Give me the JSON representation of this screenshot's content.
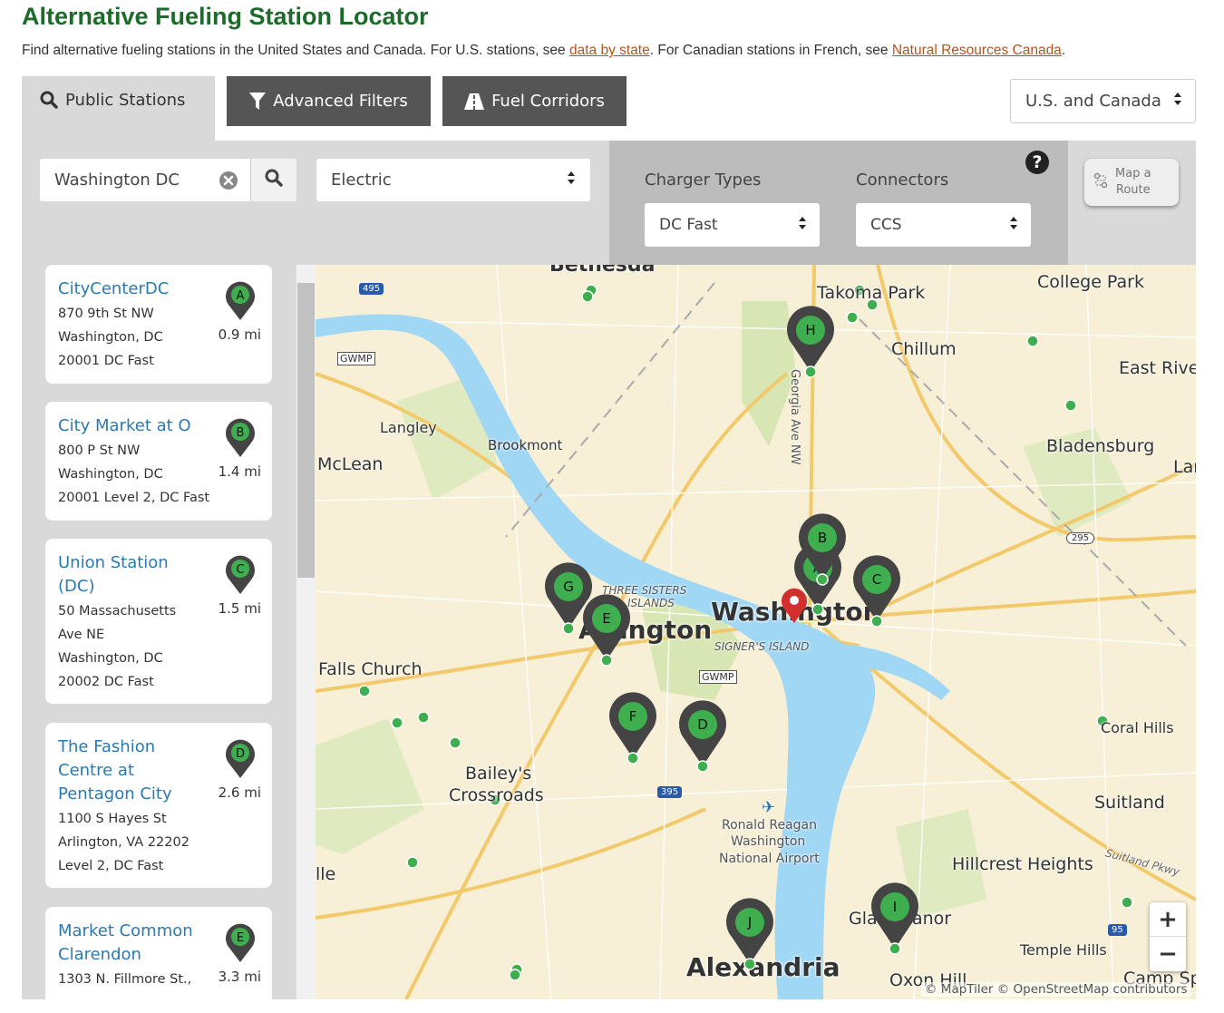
{
  "header": {
    "title": "Alternative Fueling Station Locator",
    "intro_prefix": "Find alternative fueling stations in the United States and Canada. For U.S. stations, see ",
    "intro_link1": "data by state",
    "intro_middle": ". For Canadian stations in French, see ",
    "intro_link2": "Natural Resources Canada",
    "intro_suffix": "."
  },
  "tabs": {
    "public": "Public Stations",
    "advanced": "Advanced Filters",
    "corridors": "Fuel Corridors"
  },
  "region": {
    "selected": "U.S. and Canada"
  },
  "search": {
    "location": "Washington DC",
    "fuel": "Electric"
  },
  "filters": {
    "charger_label": "Charger Types",
    "charger_value": "DC Fast",
    "connector_label": "Connectors",
    "connector_value": "CCS",
    "help": "?",
    "route_line1": "Map a",
    "route_line2": "Route"
  },
  "stations": [
    {
      "letter": "A",
      "name": "CityCenterDC",
      "address": [
        "870 9th St NW",
        "Washington, DC",
        "20001 DC Fast"
      ],
      "distance": "0.9 mi"
    },
    {
      "letter": "B",
      "name": "City Market at O",
      "address": [
        "800 P St NW",
        "Washington, DC",
        "20001 Level 2, DC Fast"
      ],
      "distance": "1.4 mi"
    },
    {
      "letter": "C",
      "name": "Union Station (DC)",
      "address": [
        "50 Massachusetts",
        "Ave NE",
        "Washington, DC",
        "20002 DC Fast"
      ],
      "distance": "1.5 mi"
    },
    {
      "letter": "D",
      "name": "The Fashion Centre at Pentagon City",
      "address": [
        "1100 S Hayes St",
        "Arlington, VA 22202",
        "Level 2, DC Fast"
      ],
      "distance": "2.6 mi"
    },
    {
      "letter": "E",
      "name": "Market Common Clarendon",
      "address": [
        "1303 N. Fillmore St.,"
      ],
      "distance": "3.3 mi"
    }
  ],
  "map": {
    "labels": {
      "bethesda": "Bethesda",
      "takoma": "Takoma Park",
      "college_park": "College Park",
      "chillum": "Chillum",
      "east_river": "East River",
      "langley": "Langley",
      "brookmont": "Brookmont",
      "bladensburg": "Bladensburg",
      "mclean": "McLean",
      "lan": "Lar",
      "washington": "Washington",
      "arlington": "Arlington",
      "three_sisters": "THREE SISTERS",
      "islands": "ISLANDS",
      "signers": "SIGNER'S ISLAND",
      "falls_church": "Falls Church",
      "coral_hills": "Coral Hills",
      "baileys": "Bailey's",
      "crossroads": "Crossroads",
      "suitland": "Suitland",
      "reagan1": "Ronald Reagan",
      "reagan2": "Washington",
      "reagan3": "National Airport",
      "hillcrest": "Hillcrest Heights",
      "suitland_pkwy": "Suitland Pkwy",
      "glassmanor": "Glassmanor",
      "temple_hills": "Temple Hills",
      "alexandria": "Alexandria",
      "oxon_hill": "Oxon Hill",
      "camp_springs": "Camp Sp",
      "ile": "lle",
      "georgia_ave": "Georgia Ave NW",
      "gwmp": "GWMP",
      "shield_495": "495",
      "shield_295": "295",
      "shield_395": "395",
      "shield_95": "95"
    },
    "markers": [
      "A",
      "B",
      "C",
      "D",
      "E",
      "F",
      "G",
      "H",
      "I",
      "J"
    ],
    "zoom_in": "+",
    "zoom_out": "−",
    "attribution": "© MapTiler © OpenStreetMap contributors"
  },
  "colors": {
    "title_green": "#1d6b2b",
    "link": "#b5541c",
    "marker_green": "#3fae4f",
    "marker_body": "#444444",
    "water": "#9fd7f5",
    "park": "#d7e6b3"
  }
}
